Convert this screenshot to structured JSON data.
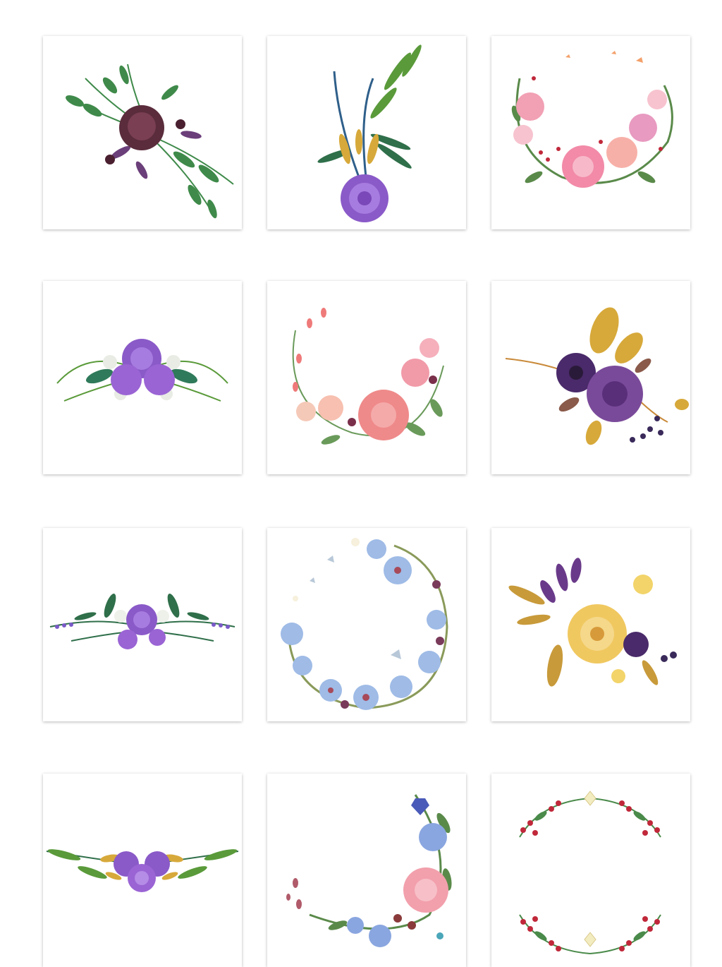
{
  "gallery": {
    "tiles": [
      {
        "subject": "dark-plum-peony-bouquet-with-green-and-purple-leaves"
      },
      {
        "subject": "violet-ranunculus-with-fern-and-gold-grass"
      },
      {
        "subject": "pink-peony-crescent-wreath-with-butterflies"
      },
      {
        "subject": "violet-rose-trio-with-fern-sprays"
      },
      {
        "subject": "coral-peony-crescent-wreath-with-berries"
      },
      {
        "subject": "purple-anemone-bouquet-with-golden-leaves"
      },
      {
        "subject": "violet-rose-horizontal-swag-with-lavender"
      },
      {
        "subject": "blue-orchid-wreath-with-butterflies"
      },
      {
        "subject": "golden-peony-bouquet-with-purple-accents"
      },
      {
        "subject": "violet-rose-garland-with-gold-grass"
      },
      {
        "subject": "blue-iris-and-pink-peony-crescent-with-crystals"
      },
      {
        "subject": "red-berry-and-cream-flower-wreath"
      }
    ]
  },
  "colors": {
    "background": "#ffffff",
    "leaf_green": "#3f8a4a",
    "dark_green": "#1f5e3a",
    "plum": "#5a2c3c",
    "violet": "#8a5ac8",
    "pink": "#f2a0b4",
    "coral": "#ef8a8a",
    "gold": "#d7a93a",
    "sky_blue": "#9fbbe6",
    "berry_red": "#c0283a"
  }
}
